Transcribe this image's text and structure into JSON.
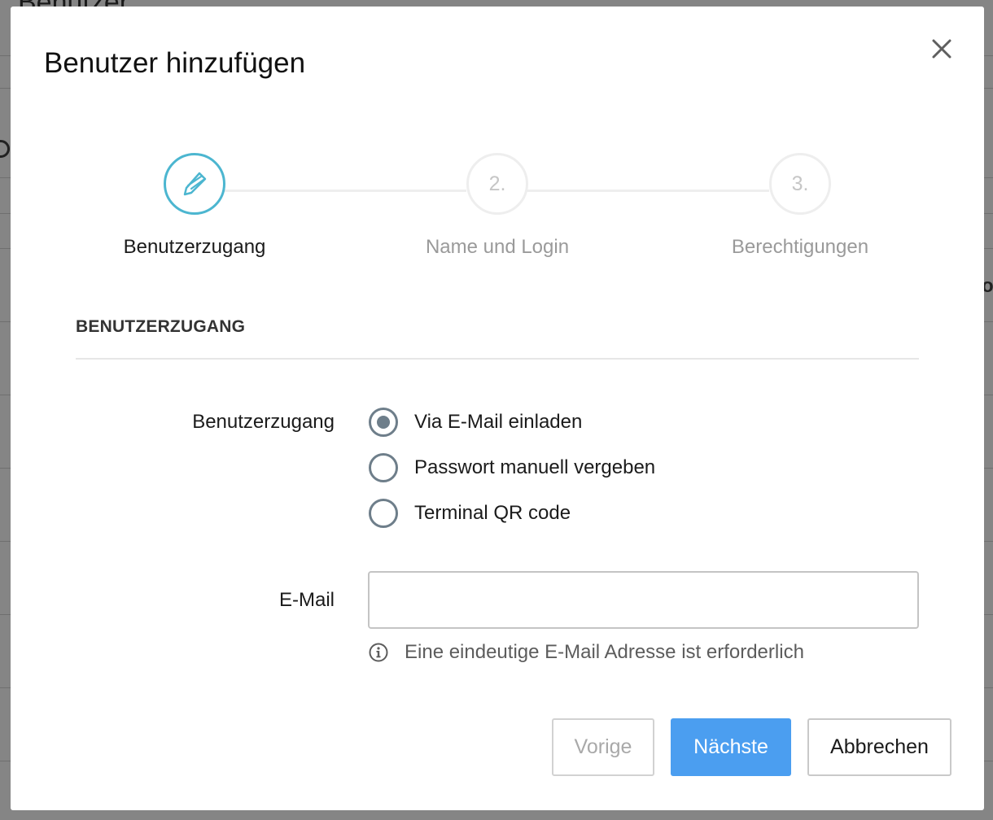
{
  "background": {
    "page_title": "Benutzer",
    "partial_char": "o"
  },
  "modal": {
    "title": "Benutzer hinzufügen",
    "close_icon": "close-icon"
  },
  "stepper": {
    "steps": [
      {
        "label": "Benutzerzugang",
        "marker": "",
        "icon": "pencil-icon",
        "state": "active"
      },
      {
        "label": "Name und Login",
        "marker": "2.",
        "state": "inactive"
      },
      {
        "label": "Berechtigungen",
        "marker": "3.",
        "state": "inactive"
      }
    ]
  },
  "section": {
    "title": "BENUTZERZUGANG"
  },
  "access": {
    "label": "Benutzerzugang",
    "selected_index": 0,
    "options": [
      {
        "label": "Via E-Mail einladen"
      },
      {
        "label": "Passwort manuell vergeben"
      },
      {
        "label": "Terminal QR code"
      }
    ]
  },
  "email": {
    "label": "E-Mail",
    "value": "",
    "placeholder": "",
    "hint": "Eine eindeutige E-Mail Adresse ist erforderlich",
    "hint_icon": "info-icon"
  },
  "footer": {
    "prev_label": "Vorige",
    "next_label": "Nächste",
    "cancel_label": "Abbrechen"
  },
  "colors": {
    "accent": "#4cb6d0",
    "primary_button": "#4b9ef0",
    "radio": "#6e7e8a"
  }
}
